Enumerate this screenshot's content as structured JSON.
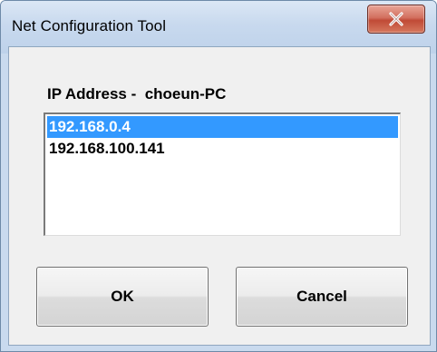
{
  "window": {
    "title": "Net Configuration Tool",
    "close_icon": "close-icon"
  },
  "ip_label": "IP Address -  choeun-PC",
  "ip_list": {
    "items": [
      {
        "text": "192.168.0.4",
        "selected": true
      },
      {
        "text": "192.168.100.141",
        "selected": false
      }
    ],
    "selected_color": "#3399ff"
  },
  "buttons": {
    "ok": "OK",
    "cancel": "Cancel"
  }
}
